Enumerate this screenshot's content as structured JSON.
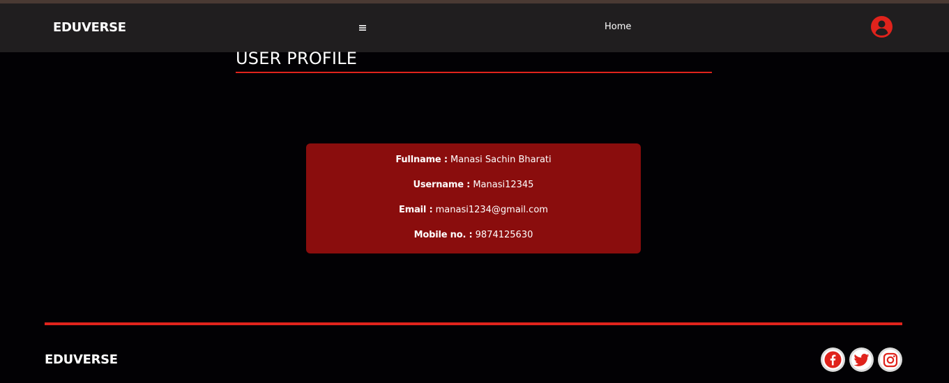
{
  "colors": {
    "accent": "#e0231c",
    "navbar_bg": "#201e1f",
    "page_bg": "#020104",
    "card_bg": "#8a0d0d"
  },
  "navbar": {
    "brand": "EDUVERSE",
    "menu_icon": "hamburger-menu-icon",
    "home_label": "Home",
    "account_icon": "user-circle-icon"
  },
  "profile": {
    "title": "USER PROFILE",
    "fields": [
      {
        "label": "Fullname :",
        "value": "Manasi Sachin Bharati"
      },
      {
        "label": "Username :",
        "value": "Manasi12345"
      },
      {
        "label": "Email :",
        "value": "manasi1234@gmail.com"
      },
      {
        "label": "Mobile no. :",
        "value": "9874125630"
      }
    ]
  },
  "footer": {
    "brand": "EDUVERSE",
    "social_icons": [
      "facebook-icon",
      "twitter-icon",
      "instagram-icon"
    ]
  }
}
